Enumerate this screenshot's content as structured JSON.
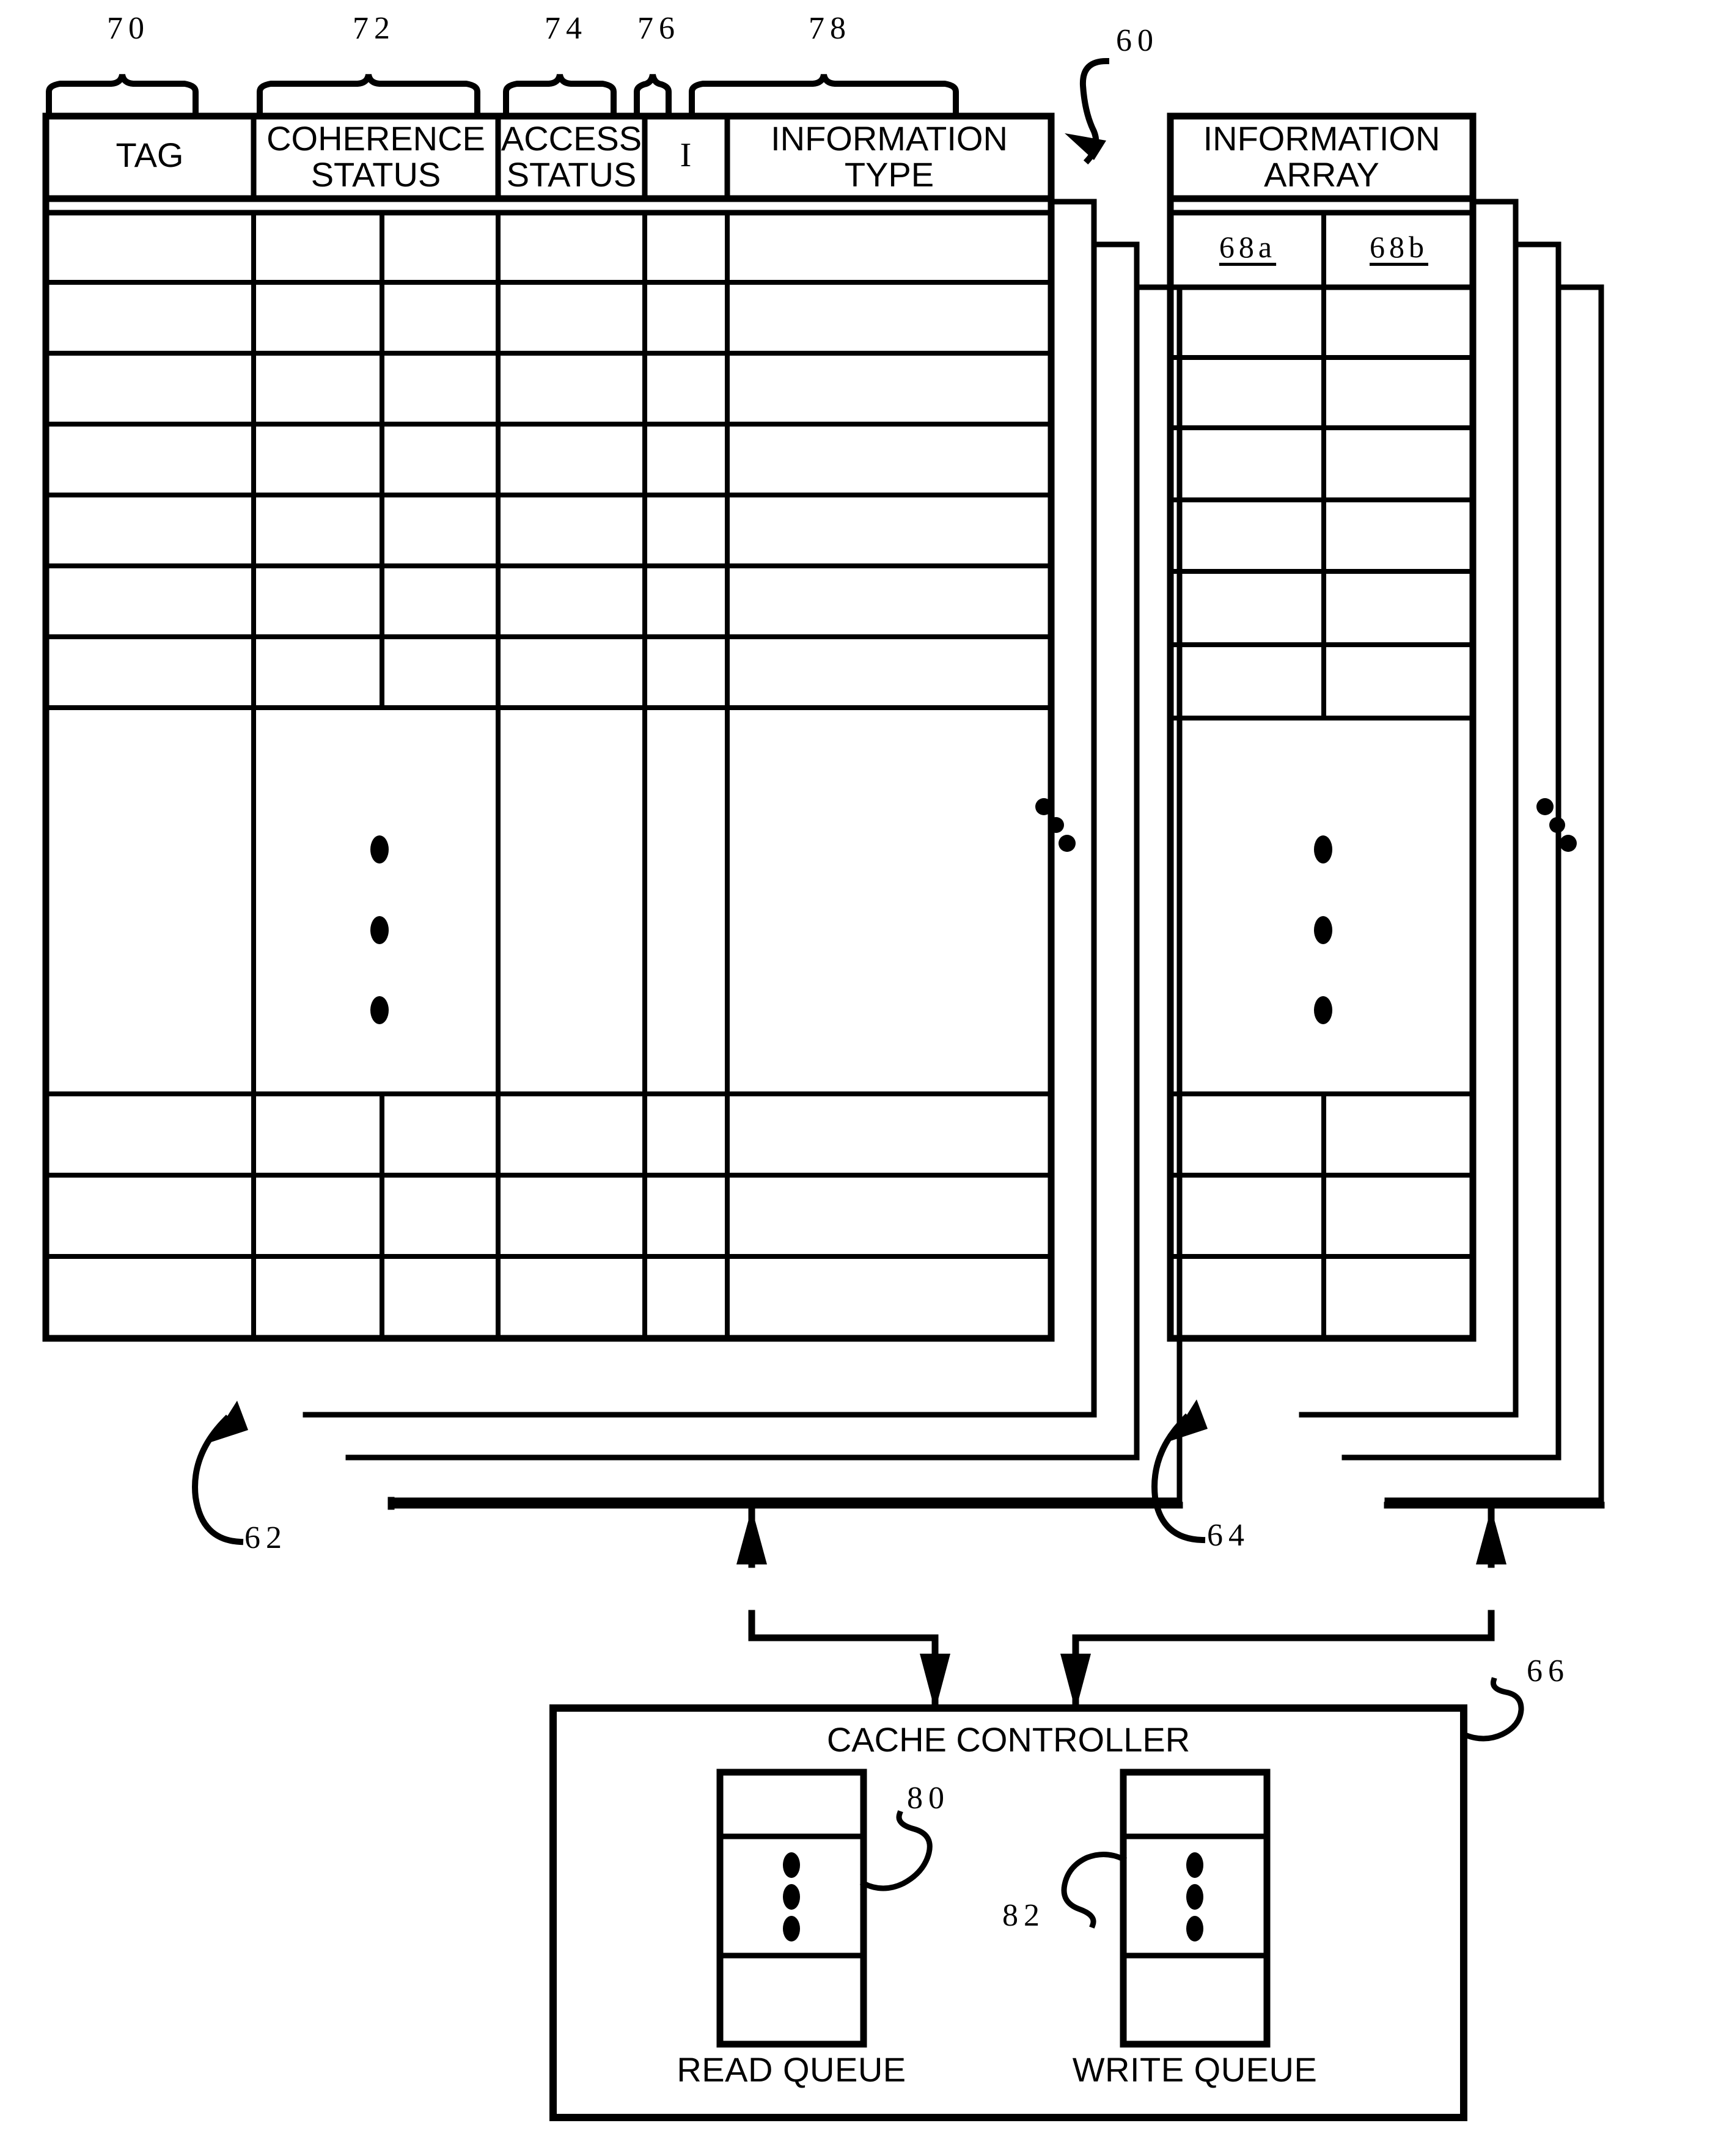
{
  "figure": {
    "title": "Cache directory and information array block diagram",
    "reference_numerals": {
      "assembly": "60",
      "directory_stack": "62",
      "array_stack": "64",
      "cache_controller": "66",
      "read_queue": "80",
      "write_queue": "82"
    }
  },
  "directory_table": {
    "columns": [
      {
        "label": "TAG",
        "ref": "70"
      },
      {
        "label": "COHERENCE\nSTATUS",
        "ref": "72"
      },
      {
        "label": "ACCESS\nSTATUS",
        "ref": "74"
      },
      {
        "label": "I",
        "ref": "76"
      },
      {
        "label": "INFORMATION\nTYPE",
        "ref": "78"
      }
    ],
    "stack_ref": "62",
    "body_rows_above_ellipsis": 7,
    "body_rows_below_ellipsis": 3,
    "ellipsis": "vertical-three-dots"
  },
  "information_array": {
    "title": "INFORMATION\nARRAY",
    "sub_columns": [
      {
        "label": "68a"
      },
      {
        "label": "68b"
      }
    ],
    "stack_ref": "64",
    "body_rows_above_ellipsis": 6,
    "body_rows_below_ellipsis": 3,
    "ellipsis": "vertical-three-dots"
  },
  "cache_controller": {
    "title": "CACHE CONTROLLER",
    "ref": "66",
    "queues": [
      {
        "label": "READ QUEUE",
        "ref": "80"
      },
      {
        "label": "WRITE QUEUE",
        "ref": "82"
      }
    ]
  },
  "colors": {
    "ink": "#000000",
    "paper": "#ffffff"
  }
}
